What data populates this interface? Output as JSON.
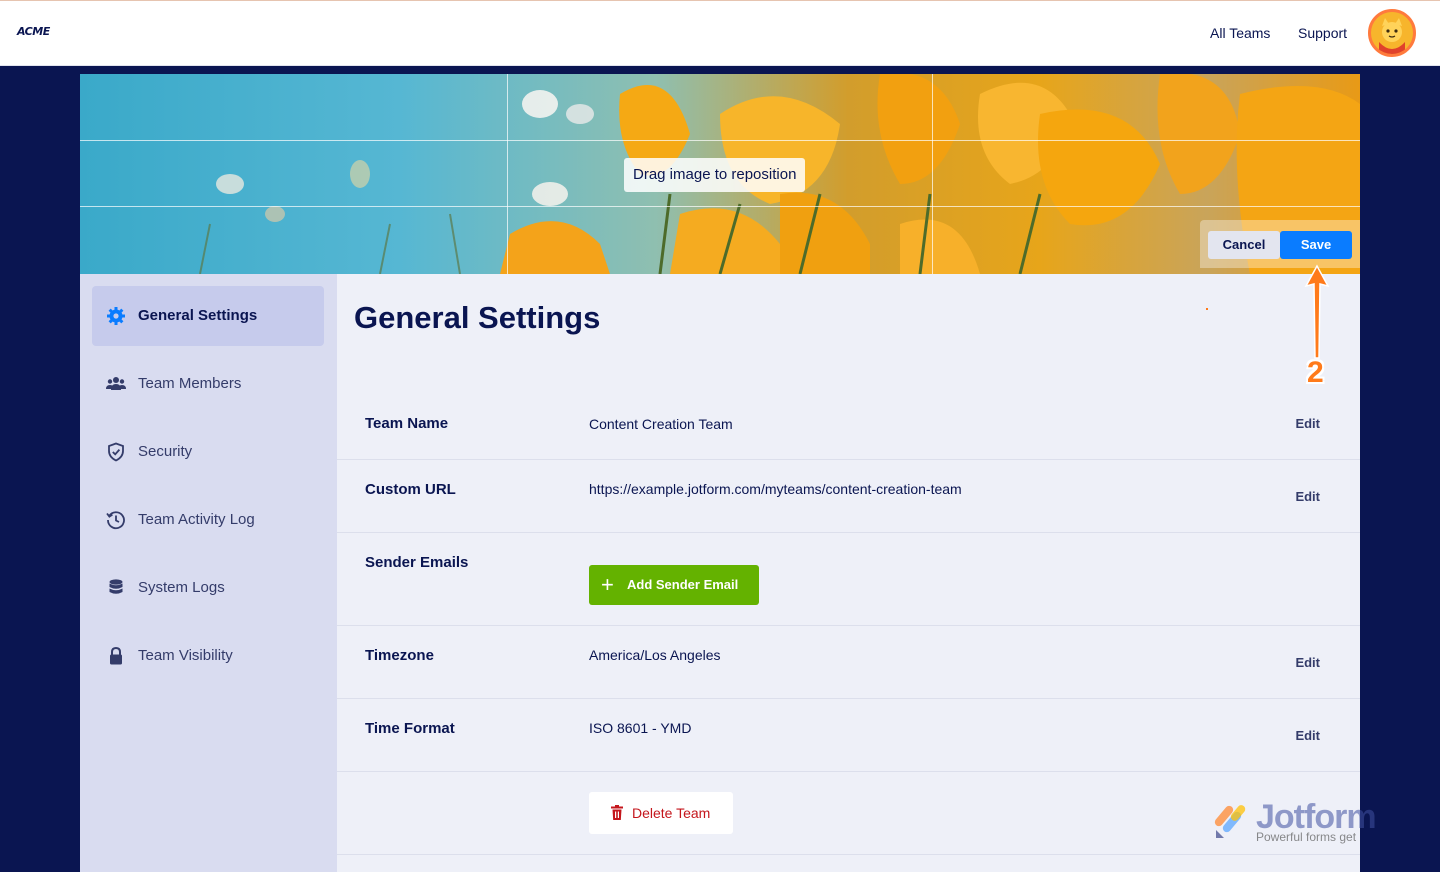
{
  "header": {
    "logo": "ACME",
    "nav": [
      {
        "label": "All Teams"
      },
      {
        "label": "Support"
      }
    ],
    "avatar_icon": "user-avatar-icon"
  },
  "cover": {
    "drag_hint": "Drag image to reposition",
    "cancel_label": "Cancel",
    "save_label": "Save"
  },
  "sidebar": {
    "items": [
      {
        "label": "General Settings",
        "icon": "gear-icon",
        "active": true
      },
      {
        "label": "Team Members",
        "icon": "users-icon",
        "active": false
      },
      {
        "label": "Security",
        "icon": "shield-icon",
        "active": false
      },
      {
        "label": "Team Activity Log",
        "icon": "history-icon",
        "active": false
      },
      {
        "label": "System Logs",
        "icon": "database-icon",
        "active": false
      },
      {
        "label": "Team Visibility",
        "icon": "lock-icon",
        "active": false
      }
    ]
  },
  "main": {
    "title": "General Settings",
    "rows": [
      {
        "label": "Team Name",
        "value": "Content Creation Team",
        "edit": "Edit"
      },
      {
        "label": "Custom URL",
        "value": "https://example.jotform.com/myteams/content-creation-team",
        "edit": "Edit"
      },
      {
        "label": "Sender Emails",
        "button": "Add Sender Email"
      },
      {
        "label": "Timezone",
        "value": "America/Los Angeles",
        "edit": "Edit"
      },
      {
        "label": "Time Format",
        "value": "ISO 8601 - YMD",
        "edit": "Edit"
      }
    ],
    "delete_label": "Delete Team"
  },
  "annotation": {
    "step": "2"
  },
  "watermark": {
    "title": "Jotform",
    "subtitle": "Powerful forms get"
  },
  "colors": {
    "navy": "#0a1551",
    "accent_blue": "#0a7cff",
    "green": "#64b200",
    "danger": "#c4161c",
    "annotation": "#ff7a1a"
  }
}
